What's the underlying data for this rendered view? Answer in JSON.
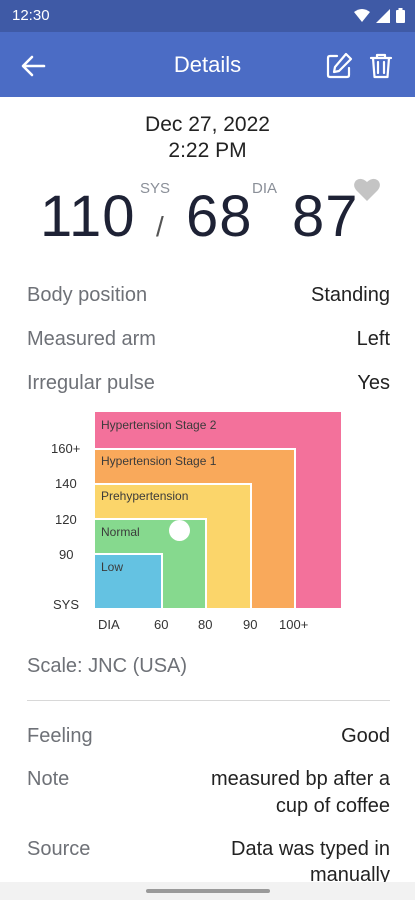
{
  "status_bar": {
    "time": "12:30"
  },
  "app_bar": {
    "title": "Details",
    "back_icon": "arrow-left-icon",
    "edit_icon": "edit-icon",
    "delete_icon": "trash-icon"
  },
  "measurement": {
    "date": "Dec 27, 2022",
    "time": "2:22 PM",
    "sys_label": "SYS",
    "dia_label": "DIA",
    "systolic": "110",
    "slash": "/",
    "diastolic": "68",
    "pulse": "87",
    "favorite_icon": "heart-icon"
  },
  "details": [
    {
      "label": "Body position",
      "value": "Standing"
    },
    {
      "label": "Measured arm",
      "value": "Left"
    },
    {
      "label": "Irregular pulse",
      "value": "Yes"
    }
  ],
  "chart": {
    "zones": [
      "Hypertension Stage 2",
      "Hypertension Stage 1",
      "Prehypertension",
      "Normal",
      "Low"
    ],
    "colors": {
      "stage2": "#f3719b",
      "stage1": "#f9a95b",
      "pre": "#fbd56a",
      "normal": "#86d98e",
      "low": "#64c2e2"
    },
    "sys_ticks": [
      "160+",
      "140",
      "120",
      "90",
      "SYS"
    ],
    "dia_ticks": [
      "DIA",
      "60",
      "80",
      "90",
      "100+"
    ]
  },
  "scale": "Scale: JNC (USA)",
  "extra": [
    {
      "label": "Feeling",
      "value": "Good"
    },
    {
      "label": "Note",
      "value_line1": "measured bp after a",
      "value_line2": "cup of coffee"
    },
    {
      "label": "Source",
      "value_line1": "Data was typed in",
      "value_line2": "manually"
    }
  ]
}
